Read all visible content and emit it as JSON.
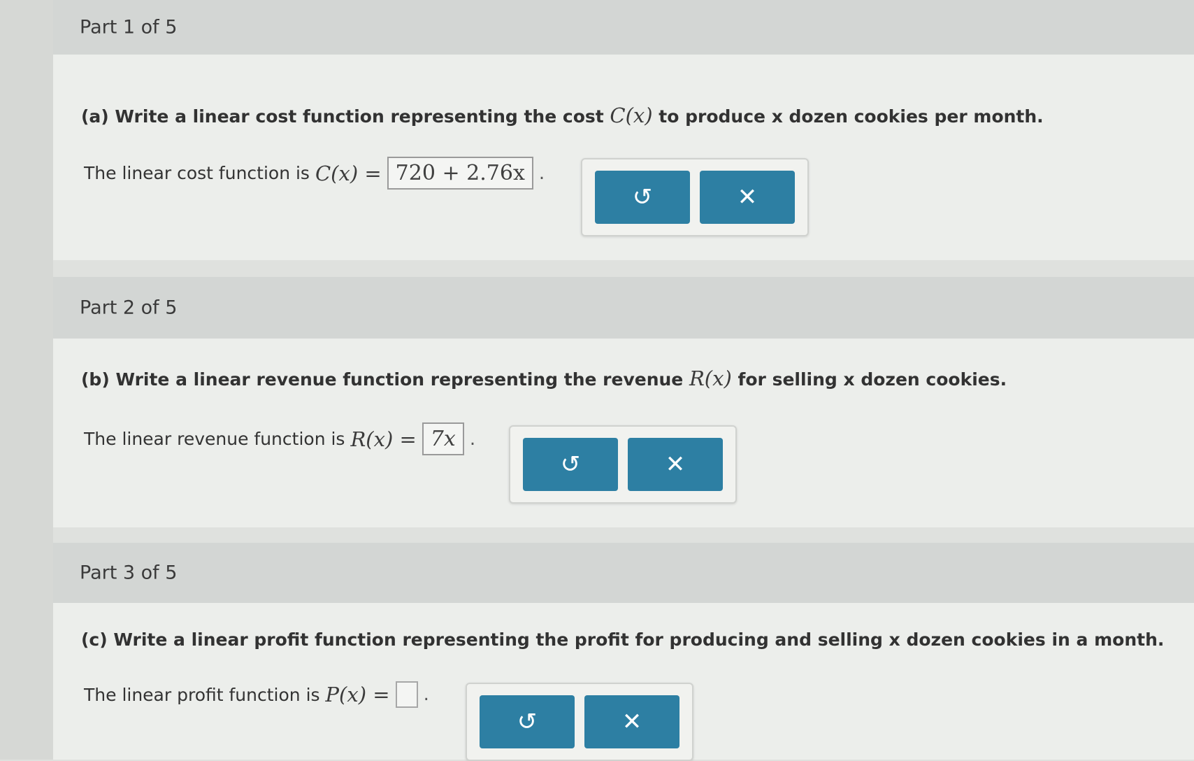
{
  "parts": [
    {
      "header": "Part 1 of 5",
      "prompt_prefix": "(a) Write a linear cost function representing the cost ",
      "prompt_func": "C(x)",
      "prompt_suffix": " to produce x dozen cookies per month.",
      "answer_prefix": "The linear cost function is ",
      "answer_func": "C(x) =",
      "answer_value": "720 + 2.76x",
      "answer_end": "."
    },
    {
      "header": "Part 2 of 5",
      "prompt_prefix": "(b) Write a linear revenue function representing the revenue ",
      "prompt_func": "R(x)",
      "prompt_suffix": " for selling x dozen cookies.",
      "answer_prefix": "The linear revenue function is ",
      "answer_func": "R(x) =",
      "answer_value": "7x",
      "answer_end": "."
    },
    {
      "header": "Part 3 of 5",
      "prompt_prefix": "(c) Write a linear profit function representing the profit for producing and selling x dozen cookies in a month.",
      "prompt_func": "",
      "prompt_suffix": "",
      "answer_prefix": "The linear profit function is ",
      "answer_func": "P(x) =",
      "answer_value": "",
      "answer_end": "."
    }
  ],
  "buttons": {
    "undo_symbol": "↺",
    "clear_symbol": "✕"
  },
  "colors": {
    "button_blue": "#2d7fa3",
    "header_gray": "#d3d6d4",
    "accent_green": "#5aad73"
  }
}
